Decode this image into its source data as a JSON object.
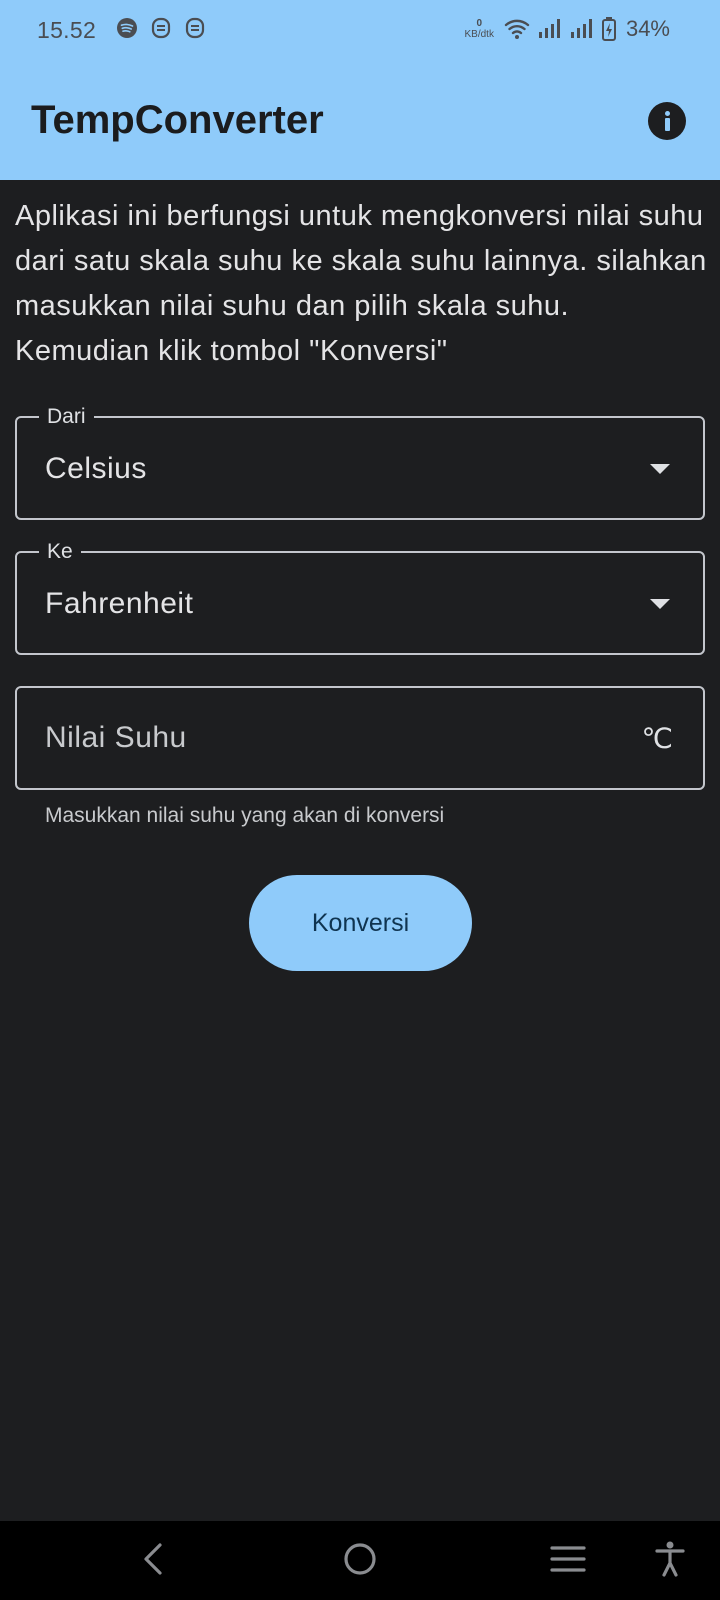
{
  "status_bar": {
    "time": "15.52",
    "left_icons": [
      "spotify-icon",
      "notification-icon",
      "notification-icon"
    ],
    "net_speed_value": "0",
    "net_speed_unit": "KB/dtk",
    "right_icons": [
      "wifi-icon",
      "signal-icon",
      "signal-icon",
      "battery-charging-icon"
    ],
    "battery": "34%"
  },
  "app_bar": {
    "title": "TempConverter",
    "info_icon": "info-icon"
  },
  "description": "Aplikasi ini berfungsi untuk mengkonversi nilai suhu dari satu skala suhu ke skala suhu lainnya. silahkan masukkan nilai suhu dan pilih skala suhu. Kemudian klik tombol \"Konversi\"",
  "form": {
    "from": {
      "label": "Dari",
      "value": "Celsius"
    },
    "to": {
      "label": "Ke",
      "value": "Fahrenheit"
    },
    "temperature": {
      "placeholder": "Nilai Suhu",
      "value": "",
      "suffix": "℃",
      "helper": "Masukkan nilai suhu yang akan di konversi"
    },
    "convert_button": "Konversi"
  },
  "nav_bar": {
    "buttons": [
      "back-icon",
      "home-icon",
      "recents-icon",
      "accessibility-icon"
    ]
  },
  "colors": {
    "accent": "#8fcbfa",
    "background": "#1d1e20",
    "text": "#e4e4e6"
  }
}
